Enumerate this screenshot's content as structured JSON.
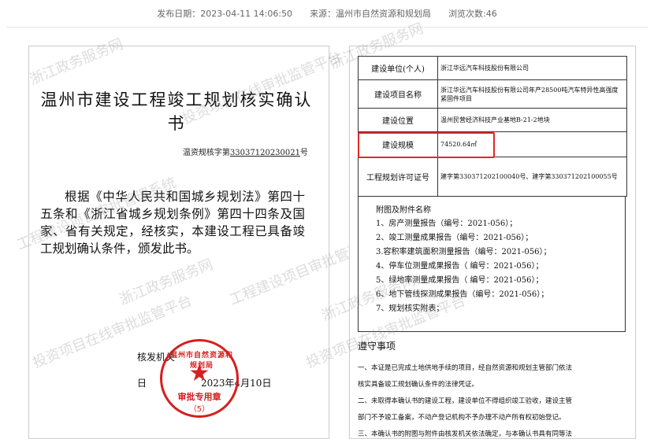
{
  "meta": {
    "publish_date": "发布日期：2023-04-11 14:06:50",
    "source": "来源：温州市自然资源和规划局",
    "views": "浏览次数:46"
  },
  "certificate": {
    "title": "温州市建设工程竣工规划核实确认书",
    "number_prefix": "温资规核字第",
    "number": "33037120230021",
    "number_suffix": "号",
    "body": "根据《中华人民共和国城乡规划法》第四十五条和《浙江省城乡规划条例》第四十四条及国家、省有关规定，经核实，本建设工程已具备竣工规划确认条件，颁发此书。",
    "issuer_label": "核发机关",
    "date_label": "日",
    "date_value": "2023年4月10日"
  },
  "seal": {
    "arc_text": "温州市自然资源和规划局",
    "name": "审批专用章",
    "number": "（5）"
  },
  "info": {
    "rows": [
      {
        "label": "建设单位(个人)",
        "value": "浙江华远汽车科技股份有限公司"
      },
      {
        "label": "建设项目名称",
        "value": "浙江华远汽车科技股份有限公司年产28500吨汽车特异性高强度紧固件项目"
      },
      {
        "label": "建设位置",
        "value": "温州民营经济科技产业基地B-21-2地块"
      },
      {
        "label": "建设规模",
        "value": "74520.64㎡"
      },
      {
        "label": "工程规划许可证号",
        "value": "建字第330371202100040号、建字第330371202100055号"
      }
    ]
  },
  "attachments": {
    "title": "附图及附件名称",
    "items": [
      "1、房产测量报告（编号：2021-056）；",
      "2、竣工测量成果报告（编号：2021-056）；",
      "3.容积率建筑面积测量报告（编号：2021-056）；",
      "4、停车位测量成果报告（ 编号：2021-056）；",
      "5、绿地率测量成果报告（ 编号：2021-056）；",
      "6、地下管线探测成果报告（编号：2021-056）；",
      "7、规划核实附表；"
    ]
  },
  "notice": {
    "title": "遵守事项",
    "lines": [
      "一、本证是已完成土地供地手续的项目，经自然资源和规划主管部门依法",
      "核实具备竣工规划确认条件的法律凭证。",
      "二、未取得本确认书的建设工程，建设单位不得组织竣工验收，建设主管",
      "部门不予竣工备案，不动产登记机构不予办理不动产所有权初始登记。",
      "三、本确认书的附图与附件由核发机关依法确定，与本确认书具有同等法"
    ]
  },
  "watermarks": [
    "浙江政务服务网",
    "投资项目在线审批监管平台",
    "工程建设项目审批管理系统"
  ],
  "colors": {
    "seal_red": "#d81e1e",
    "highlight_red": "#e12828",
    "meta_text": "#666666"
  }
}
